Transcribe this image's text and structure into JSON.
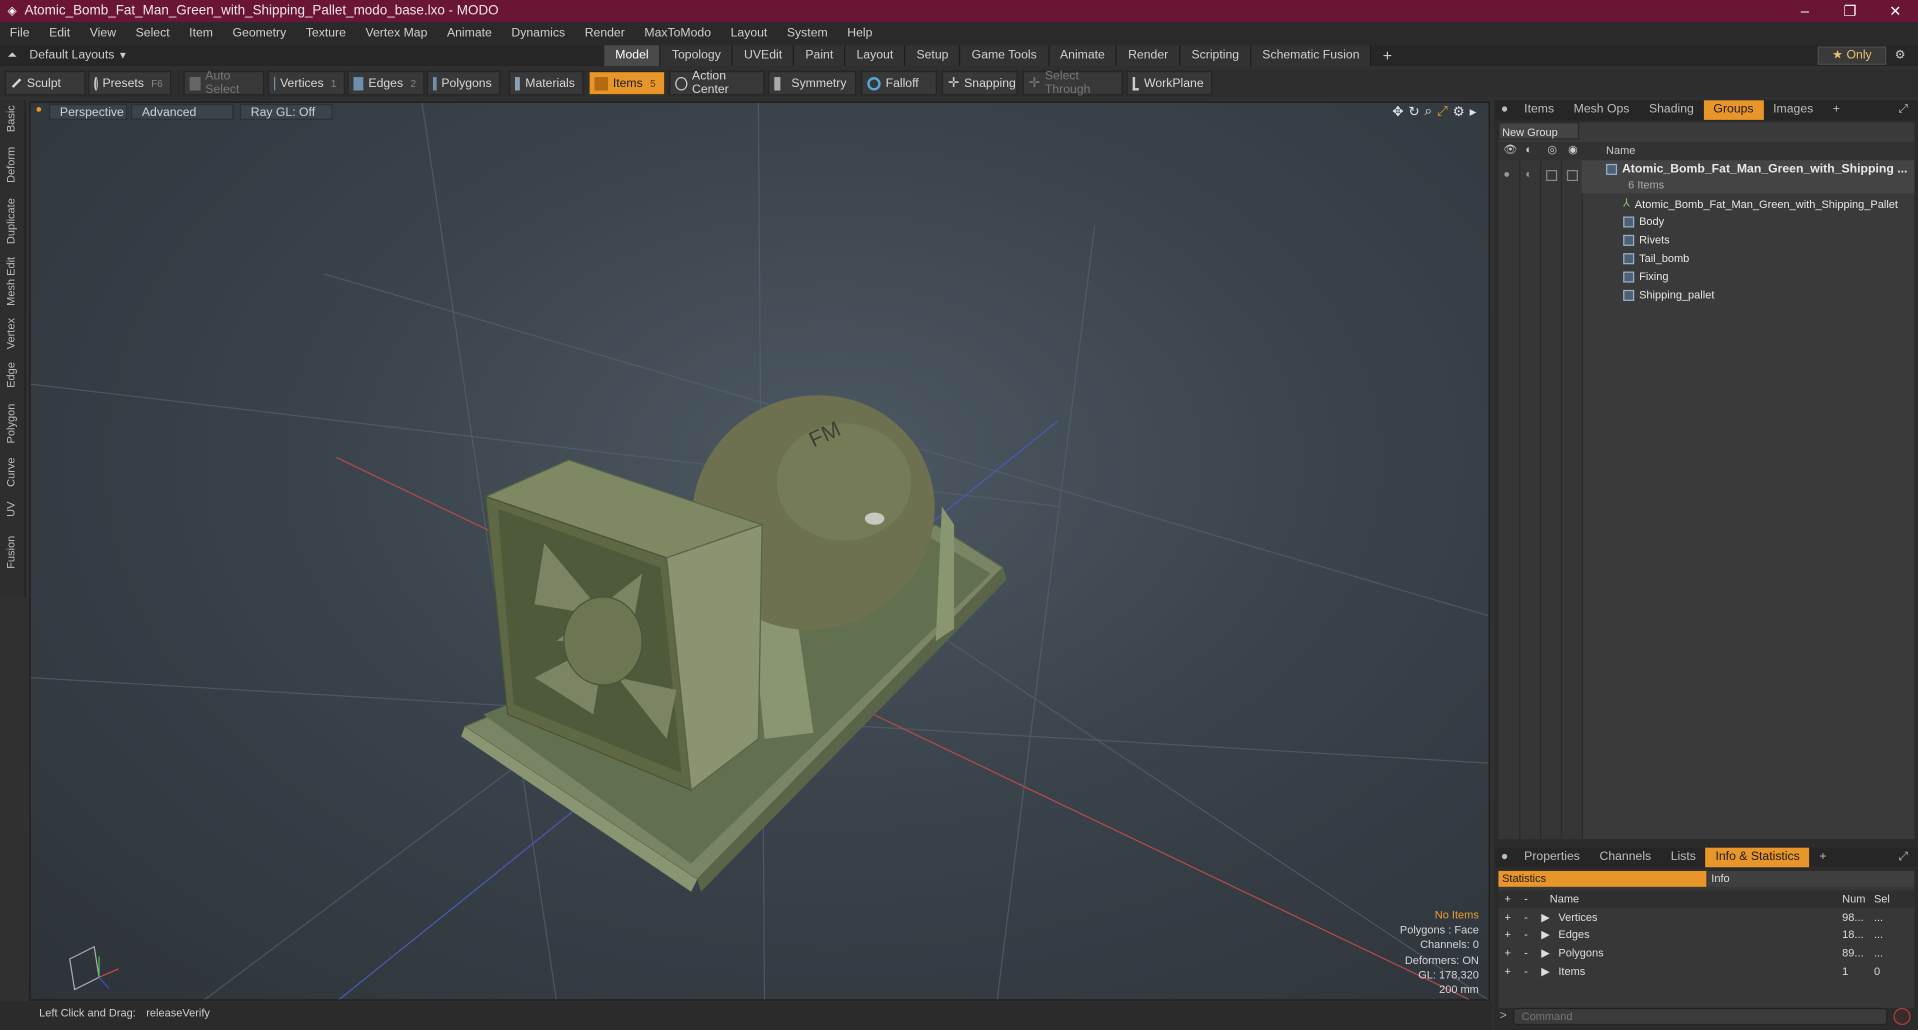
{
  "window": {
    "title": "Atomic_Bomb_Fat_Man_Green_with_Shipping_Pallet_modo_base.lxo - MODO",
    "controls": [
      "–",
      "❐",
      "✕"
    ]
  },
  "menu": [
    "File",
    "Edit",
    "View",
    "Select",
    "Item",
    "Geometry",
    "Texture",
    "Vertex Map",
    "Animate",
    "Dynamics",
    "Render",
    "MaxToModo",
    "Layout",
    "System",
    "Help"
  ],
  "layouts": {
    "current": "Default Layouts",
    "tabs": [
      "Model",
      "Topology",
      "UVEdit",
      "Paint",
      "Layout",
      "Setup",
      "Game Tools",
      "Animate",
      "Render",
      "Scripting",
      "Schematic Fusion"
    ],
    "active_tab": "Model",
    "add_label": "+",
    "only_label": "★  Only"
  },
  "toolbar": {
    "sculpt": "Sculpt",
    "presets": "Presets",
    "presets_key": "F6",
    "auto_select": "Auto Select",
    "vertices": "Vertices",
    "vertices_count": "1",
    "edges": "Edges",
    "edges_count": "2",
    "polygons": "Polygons",
    "materials": "Materials",
    "items": "Items",
    "items_count": "5",
    "action_center": "Action Center",
    "symmetry": "Symmetry",
    "falloff": "Falloff",
    "snapping": "Snapping",
    "select_through": "Select Through",
    "workplane": "WorkPlane"
  },
  "left_strip": [
    "Basic",
    "Deform",
    "Duplicate",
    "Mesh Edit",
    "Vertex",
    "Edge",
    "Polygon",
    "Curve",
    "UV",
    "Fusion"
  ],
  "viewport": {
    "perspective": "Perspective",
    "advanced": "Advanced",
    "raygl": "Ray GL: Off",
    "hud": {
      "no_items": "No Items",
      "polygons": "Polygons : Face",
      "channels": "Channels: 0",
      "deformers": "Deformers: ON",
      "gl": "GL: 178,320",
      "scale": "200 mm"
    },
    "model_label": "FM"
  },
  "status": {
    "hint": "Left Click and Drag:",
    "action": "releaseVerify"
  },
  "right_tabs": {
    "tabs": [
      "Items",
      "Mesh Ops",
      "Shading",
      "Groups",
      "Images"
    ],
    "active": "Groups",
    "add": "+"
  },
  "groups": {
    "new_group": "New Group",
    "name_header": "Name",
    "root": "Atomic_Bomb_Fat_Man_Green_with_Shipping ...",
    "root_count": "6 Items",
    "children": [
      "Atomic_Bomb_Fat_Man_Green_with_Shipping_Pallet",
      "Body",
      "Rivets",
      "Tail_bomb",
      "Fixing",
      "Shipping_pallet"
    ]
  },
  "bottom_tabs": {
    "tabs": [
      "Properties",
      "Channels",
      "Lists",
      "Info & Statistics"
    ],
    "active": "Info & Statistics",
    "add": "+"
  },
  "stats": {
    "statistics_tab": "Statistics",
    "info_tab": "Info",
    "headers": {
      "name": "Name",
      "num": "Num",
      "sel": "Sel"
    },
    "rows": [
      {
        "name": "Vertices",
        "num": "98...",
        "sel": "..."
      },
      {
        "name": "Edges",
        "num": "18...",
        "sel": "..."
      },
      {
        "name": "Polygons",
        "num": "89...",
        "sel": "..."
      },
      {
        "name": "Items",
        "num": "1",
        "sel": "0"
      }
    ]
  },
  "command": {
    "placeholder": "Command",
    "prompt": ">"
  }
}
